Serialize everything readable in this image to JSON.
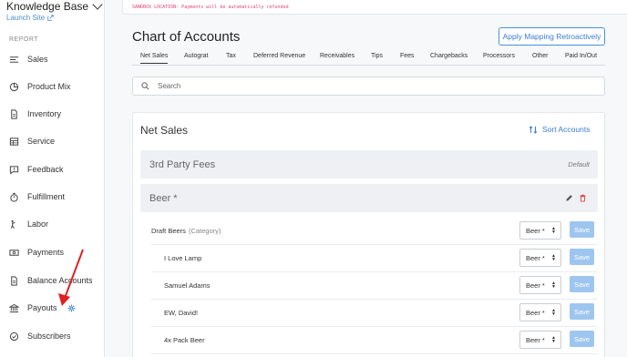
{
  "sidebar": {
    "kb_title": "Knowledge Base",
    "launch_site": "Launch Site",
    "section": "REPORT",
    "items": [
      {
        "label": "Sales"
      },
      {
        "label": "Product Mix"
      },
      {
        "label": "Inventory"
      },
      {
        "label": "Service"
      },
      {
        "label": "Feedback"
      },
      {
        "label": "Fulfillment"
      },
      {
        "label": "Labor"
      },
      {
        "label": "Payments"
      },
      {
        "label": "Balance Accounts"
      },
      {
        "label": "Payouts"
      },
      {
        "label": "Subscribers"
      }
    ]
  },
  "sandbox": {
    "text": "SANDBOX LOCATION: Payments will be automatically refunded"
  },
  "page": {
    "title": "Chart of Accounts",
    "apply_button": "Apply Mapping Retroactively",
    "tabs": [
      "Net Sales",
      "Autograt",
      "Tax",
      "Deferred Revenue",
      "Receivables",
      "Tips",
      "Fees",
      "Chargebacks",
      "Processors",
      "Other",
      "Paid In/Out"
    ],
    "search_placeholder": "Search"
  },
  "card": {
    "title": "Net Sales",
    "sort_button": "Sort Accounts",
    "groups": [
      {
        "name": "3rd Party Fees",
        "tag": "Default"
      },
      {
        "name": "Beer *"
      }
    ],
    "rows": [
      {
        "label": "Draft Beers",
        "category": "(Category)",
        "select": "Beer *",
        "save": "Save"
      },
      {
        "label": "I Love Lamp",
        "select": "Beer *",
        "save": "Save"
      },
      {
        "label": "Samuel Adams",
        "select": "Beer *",
        "save": "Save"
      },
      {
        "label": "EW, David!",
        "select": "Beer *",
        "save": "Save"
      },
      {
        "label": "4x Pack Beer",
        "select": "Beer *",
        "save": "Save"
      }
    ]
  },
  "colors": {
    "accent": "#3a7bd5",
    "save_bg": "#9ec5ef",
    "sandbox_text": "#e0457b",
    "annotation_arrow": "#e02020"
  }
}
